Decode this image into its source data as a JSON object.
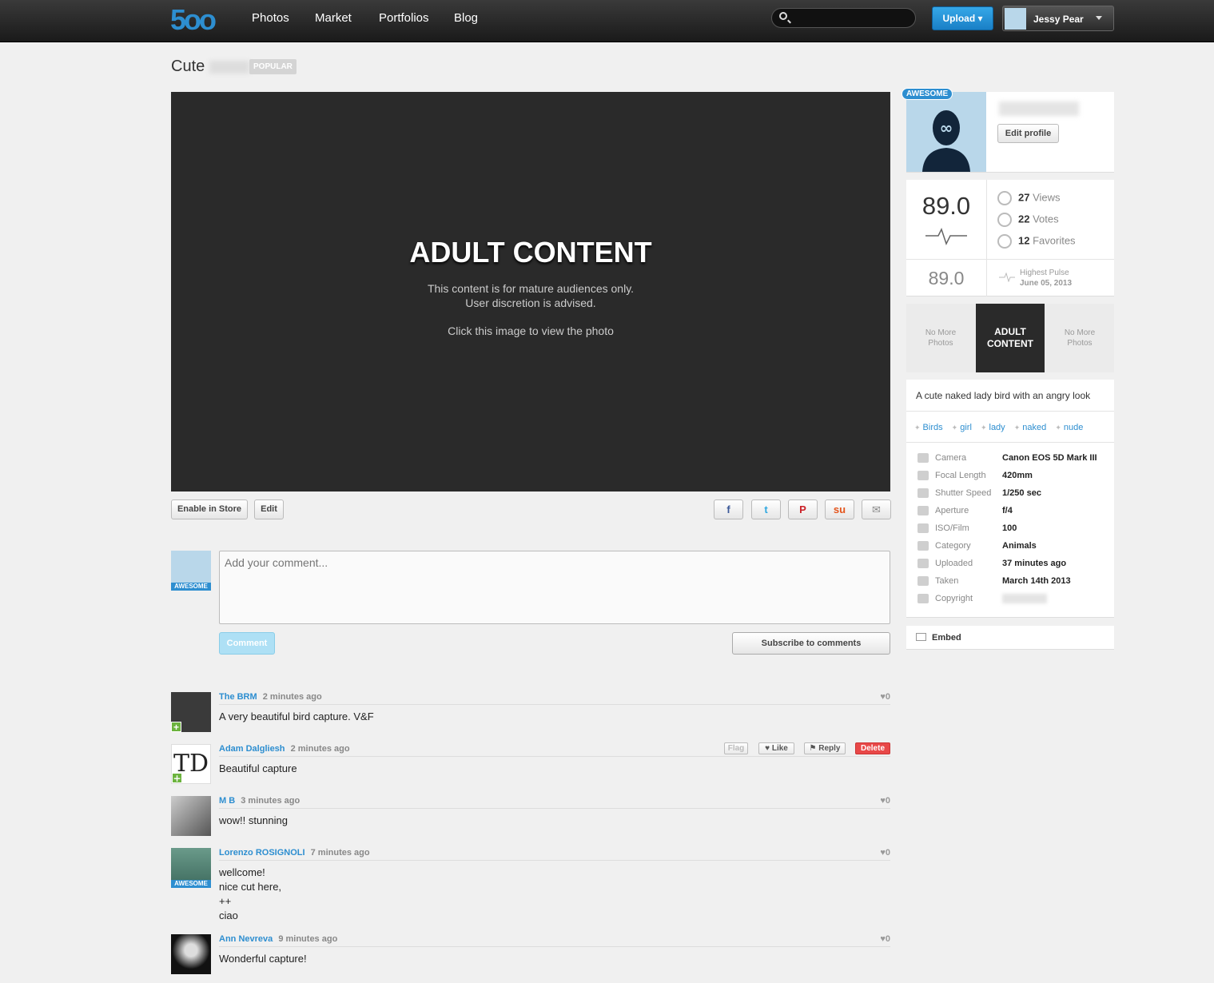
{
  "nav": {
    "logo": "5oo",
    "items": [
      "Photos",
      "Market",
      "Portfolios",
      "Blog"
    ],
    "search_placeholder": "",
    "upload": "Upload",
    "user": "Jessy Pear"
  },
  "photo": {
    "title": "Cute",
    "badge": "POPULAR",
    "overlay_title": "ADULT CONTENT",
    "overlay_line1": "This content is for mature audiences only.",
    "overlay_line2": "User discretion is advised.",
    "overlay_cta": "Click this image to view the photo",
    "actions": [
      "Enable in Store",
      "Edit"
    ],
    "share_icons": [
      "facebook-icon",
      "twitter-icon",
      "pinterest-icon",
      "stumbleupon-icon",
      "email-icon"
    ]
  },
  "compose": {
    "placeholder": "Add your comment...",
    "badge": "AWESOME",
    "comment_btn": "Comment",
    "subscribe_btn": "Subscribe to comments"
  },
  "comments": [
    {
      "user": "The BRM",
      "time": "2 minutes ago",
      "likes": "0",
      "body": [
        "A very beautiful bird capture. V&F"
      ]
    },
    {
      "user": "Adam Dalgliesh",
      "time": "2 minutes ago",
      "likes": "",
      "body": [
        "Beautiful capture"
      ]
    },
    {
      "user": "M B",
      "time": "3 minutes ago",
      "likes": "0",
      "body": [
        "wow!! stunning"
      ]
    },
    {
      "user": "Lorenzo ROSIGNOLI",
      "time": "7 minutes ago",
      "likes": "0",
      "body": [
        "wellcome!",
        "nice cut here,",
        "++",
        "ciao"
      ]
    },
    {
      "user": "Ann Nevreva",
      "time": "9 minutes ago",
      "likes": "0",
      "body": [
        "Wonderful capture!"
      ]
    }
  ],
  "comment_actions": {
    "flag": "Flag",
    "like": "Like",
    "reply": "Reply",
    "delete": "Delete"
  },
  "sidebar": {
    "awesome": "AWESOME",
    "edit_profile": "Edit profile",
    "pulse": "89.0",
    "highest_pulse_value": "89.0",
    "highest_pulse_label": "Highest Pulse",
    "highest_pulse_date": "June 05, 2013",
    "stats": [
      {
        "value": "27",
        "label": "Views"
      },
      {
        "value": "22",
        "label": "Votes"
      },
      {
        "value": "12",
        "label": "Favorites"
      }
    ],
    "strip_left": "No More\nPhotos",
    "strip_center": "ADULT\nCONTENT",
    "strip_right": "No More\nPhotos",
    "description": "A cute naked lady bird with an angry look",
    "tags": [
      "Birds",
      "girl",
      "lady",
      "naked",
      "nude"
    ],
    "exif": [
      {
        "label": "Camera",
        "value": "Canon EOS 5D Mark III"
      },
      {
        "label": "Focal Length",
        "value": "420mm"
      },
      {
        "label": "Shutter Speed",
        "value": "1/250 sec"
      },
      {
        "label": "Aperture",
        "value": "f/4"
      },
      {
        "label": "ISO/Film",
        "value": "100"
      },
      {
        "label": "Category",
        "value": "Animals"
      },
      {
        "label": "Uploaded",
        "value": "37 minutes ago"
      },
      {
        "label": "Taken",
        "value": "March 14th 2013"
      },
      {
        "label": "Copyright",
        "value": ""
      }
    ],
    "embed": "Embed"
  }
}
